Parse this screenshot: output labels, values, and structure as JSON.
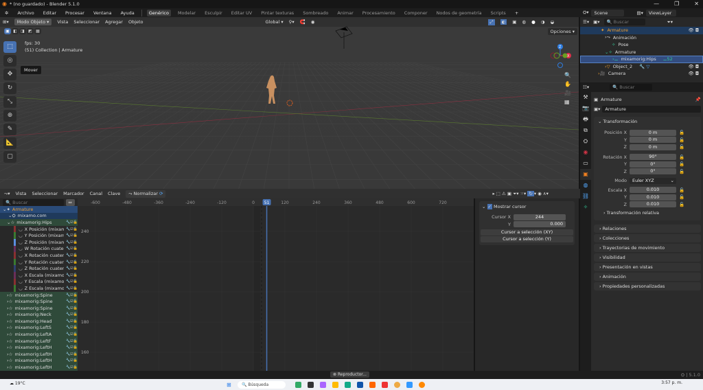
{
  "window": {
    "title": "* (no guardado) - Blender 5.1.0",
    "controls": [
      "—",
      "❐",
      "✕"
    ]
  },
  "menu": [
    "Archivo",
    "Editar",
    "Procesar",
    "Ventana",
    "Ayuda"
  ],
  "workspaces": [
    "Genérico",
    "Modelar",
    "Esculpir",
    "Editar UV",
    "Pintar texturas",
    "Sombreado",
    "Animar",
    "Procesamiento",
    "Componer",
    "Nodos de geometría",
    "Scripts",
    "+"
  ],
  "active_workspace": "Genérico",
  "viewport": {
    "mode": "Modo Objeto",
    "menus": [
      "Vista",
      "Seleccionar",
      "Agregar",
      "Objeto"
    ],
    "orientation": "Global",
    "options": "Opciones",
    "overlay_fps": "fps: 30",
    "overlay_collection": "(51) Collection | Armature",
    "tooltip": "Mover",
    "tools": [
      "select-box",
      "cursor",
      "move",
      "rotate",
      "scale",
      "transform",
      "annotate",
      "measure",
      "add-cube"
    ],
    "gizmo": {
      "z": "Z",
      "x": "X",
      "y": "Y"
    }
  },
  "outliner": {
    "scene": "Scene",
    "view_layer": "ViewLayer",
    "search_placeholder": "Buscar",
    "items": [
      {
        "label": "Armature",
        "type": "armature",
        "active": true
      },
      {
        "label": "Animación",
        "type": "animation"
      },
      {
        "label": "Pose",
        "type": "pose"
      },
      {
        "label": "Armature",
        "type": "armature-data"
      },
      {
        "label": "mixamorig:Hips",
        "type": "bone",
        "selected": true,
        "badge": "52"
      },
      {
        "label": "Object_2",
        "type": "mesh"
      },
      {
        "label": "Camera",
        "type": "camera"
      }
    ]
  },
  "properties": {
    "search_placeholder": "Buscar",
    "object_name": "Armature",
    "data_name": "Armature",
    "section": "Transformación",
    "position": {
      "label": "Posición X",
      "x": "0 m",
      "y": "0 m",
      "z": "0 m"
    },
    "rotation": {
      "label": "Rotación X",
      "x": "90°",
      "y": "0°",
      "z": "0°"
    },
    "mode": {
      "label": "Modo",
      "value": "Euler XYZ"
    },
    "scale": {
      "label": "Escala X",
      "x": "0.010",
      "y": "0.010",
      "z": "0.010"
    },
    "axis": {
      "y": "Y",
      "z": "Z"
    },
    "subpanels": [
      "Transformación relativa",
      "Relaciones",
      "Colecciones",
      "Trayectorias de movimiento",
      "Visibilidad",
      "Presentación en vistas",
      "Animación",
      "Propiedades personalizadas"
    ]
  },
  "graph": {
    "menus": [
      "Vista",
      "Seleccionar",
      "Marcador",
      "Canal",
      "Clave"
    ],
    "normalize": "Normalizar",
    "search_placeholder": "Buscar",
    "current_frame": "51",
    "x_ticks": [
      "-600",
      "-480",
      "-360",
      "-240",
      "-120",
      "0",
      "120",
      "240",
      "360",
      "480",
      "600",
      "720"
    ],
    "y_ticks": [
      "240",
      "220",
      "200",
      "180",
      "160"
    ],
    "channels": [
      {
        "label": "Armature",
        "kind": "a"
      },
      {
        "label": "mixamo.com",
        "kind": "o"
      },
      {
        "label": "mixamorig:Hips",
        "kind": "g"
      },
      {
        "label": "X Posición (mixamc",
        "color": "#8a3030"
      },
      {
        "label": "Y Posición (mixamc",
        "color": "#3a7a30"
      },
      {
        "label": "Z Posición (mixamc",
        "color": "#5a8fe0"
      },
      {
        "label": "W Rotación cuatern",
        "color": "#6a2f5a"
      },
      {
        "label": "X Rotación cuaterni",
        "color": "#8a3030"
      },
      {
        "label": "Y Rotación cuaterni",
        "color": "#3a7a30"
      },
      {
        "label": "Z Rotación cuaterni",
        "color": "#2f4070"
      },
      {
        "label": "X Escala (mixamori",
        "color": "#6a2f5a"
      },
      {
        "label": "Y Escala (mixamori",
        "color": "#8a3030"
      },
      {
        "label": "Z Escala (mixamori",
        "color": "#3a7a30"
      },
      {
        "label": "mixamorig:Spine",
        "kind": "g"
      },
      {
        "label": "mixamorig:Spine",
        "kind": "g"
      },
      {
        "label": "mixamorig:Spine",
        "kind": "g"
      },
      {
        "label": "mixamorig:Neck",
        "kind": "g"
      },
      {
        "label": "mixamorig:Head",
        "kind": "g"
      },
      {
        "label": "mixamorig:LeftS",
        "kind": "g"
      },
      {
        "label": "mixamorig:LeftA",
        "kind": "g"
      },
      {
        "label": "mixamorig:LeftF",
        "kind": "g"
      },
      {
        "label": "mixamorig:LeftH",
        "kind": "g"
      },
      {
        "label": "mixamorig:LeftH",
        "kind": "g"
      },
      {
        "label": "mixamorig:LeftH",
        "kind": "g"
      },
      {
        "label": "mixamorig:LeftH",
        "kind": "g"
      }
    ],
    "sidebar": {
      "panel": "Mostrar cursor",
      "cursor_x_label": "Cursor X",
      "cursor_x": "244",
      "y_label": "Y",
      "cursor_y": "0.000",
      "btn_xy": "Cursor a selección (XY)",
      "btn_y": "Cursor a selección (Y)"
    }
  },
  "statusbar": {
    "playback": "Reproductor...",
    "version": "5.1.0"
  },
  "taskbar": {
    "weather": "19°C",
    "search": "Búsqueda",
    "time": "3:57 p. m."
  },
  "colors": {
    "accent": "#4772b3",
    "active_object": "#f0a030",
    "selected_row": "#334d80"
  }
}
